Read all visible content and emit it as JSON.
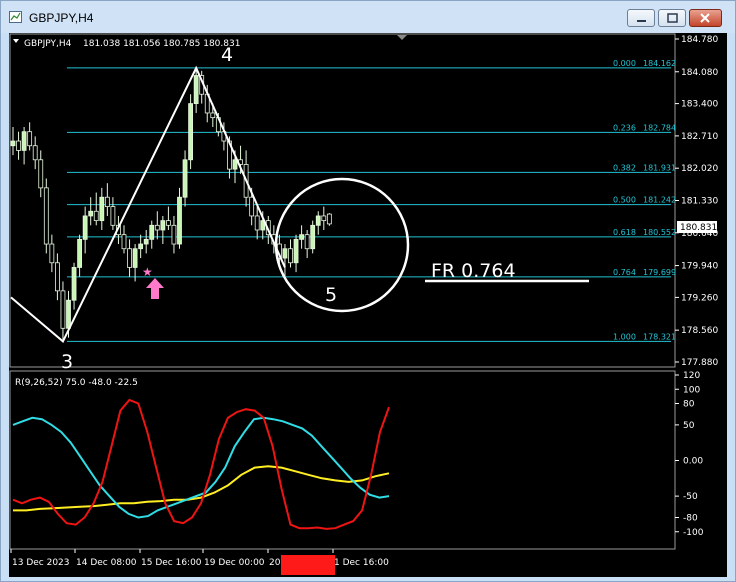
{
  "window": {
    "title": "GBPJPY,H4"
  },
  "chart_data": {
    "type": "candlestick",
    "symbol_label": "GBPJPY,H4",
    "ohlc_label": "181.038 181.056 180.785 180.831",
    "price_axis_ticks": [
      "184.780",
      "184.080",
      "183.400",
      "182.710",
      "182.020",
      "181.330",
      "180.640",
      "179.940",
      "179.260",
      "178.560",
      "177.880"
    ],
    "current_price": "180.831",
    "y_range": [
      177.88,
      184.78
    ],
    "candles": [
      {
        "o": 182.5,
        "h": 182.9,
        "l": 182.3,
        "c": 182.6
      },
      {
        "o": 182.6,
        "h": 182.8,
        "l": 182.2,
        "c": 182.4
      },
      {
        "o": 182.4,
        "h": 182.9,
        "l": 182.1,
        "c": 182.8
      },
      {
        "o": 182.8,
        "h": 183.0,
        "l": 182.4,
        "c": 182.5
      },
      {
        "o": 182.5,
        "h": 182.7,
        "l": 182.0,
        "c": 182.2
      },
      {
        "o": 182.2,
        "h": 182.4,
        "l": 181.4,
        "c": 181.6
      },
      {
        "o": 181.6,
        "h": 181.8,
        "l": 180.2,
        "c": 180.4
      },
      {
        "o": 180.4,
        "h": 180.6,
        "l": 179.8,
        "c": 180.0
      },
      {
        "o": 180.0,
        "h": 180.2,
        "l": 179.2,
        "c": 179.4
      },
      {
        "o": 179.4,
        "h": 179.6,
        "l": 178.32,
        "c": 178.6
      },
      {
        "o": 178.6,
        "h": 179.4,
        "l": 178.4,
        "c": 179.2
      },
      {
        "o": 179.2,
        "h": 180.0,
        "l": 179.0,
        "c": 179.9
      },
      {
        "o": 179.9,
        "h": 180.6,
        "l": 179.7,
        "c": 180.5
      },
      {
        "o": 180.5,
        "h": 181.2,
        "l": 180.2,
        "c": 181.0
      },
      {
        "o": 181.0,
        "h": 181.4,
        "l": 180.8,
        "c": 181.1
      },
      {
        "o": 181.1,
        "h": 181.5,
        "l": 180.8,
        "c": 180.9
      },
      {
        "o": 180.9,
        "h": 181.6,
        "l": 180.7,
        "c": 181.4
      },
      {
        "o": 181.4,
        "h": 181.7,
        "l": 181.0,
        "c": 181.2
      },
      {
        "o": 181.2,
        "h": 181.4,
        "l": 180.7,
        "c": 180.8
      },
      {
        "o": 180.8,
        "h": 181.0,
        "l": 180.4,
        "c": 180.6
      },
      {
        "o": 180.6,
        "h": 180.8,
        "l": 180.2,
        "c": 180.3
      },
      {
        "o": 180.3,
        "h": 180.5,
        "l": 179.7,
        "c": 179.9
      },
      {
        "o": 179.9,
        "h": 180.4,
        "l": 179.6,
        "c": 180.3
      },
      {
        "o": 180.3,
        "h": 180.6,
        "l": 180.1,
        "c": 180.4
      },
      {
        "o": 180.4,
        "h": 180.7,
        "l": 180.2,
        "c": 180.5
      },
      {
        "o": 180.5,
        "h": 180.9,
        "l": 180.3,
        "c": 180.8
      },
      {
        "o": 180.8,
        "h": 181.1,
        "l": 180.5,
        "c": 180.7
      },
      {
        "o": 180.7,
        "h": 181.0,
        "l": 180.4,
        "c": 180.9
      },
      {
        "o": 180.9,
        "h": 181.2,
        "l": 180.7,
        "c": 180.8
      },
      {
        "o": 180.8,
        "h": 181.0,
        "l": 180.2,
        "c": 180.4
      },
      {
        "o": 180.4,
        "h": 181.6,
        "l": 180.3,
        "c": 181.4
      },
      {
        "o": 181.4,
        "h": 182.4,
        "l": 181.2,
        "c": 182.2
      },
      {
        "o": 182.2,
        "h": 183.6,
        "l": 182.0,
        "c": 183.4
      },
      {
        "o": 183.4,
        "h": 184.16,
        "l": 183.2,
        "c": 184.0
      },
      {
        "o": 184.0,
        "h": 184.1,
        "l": 183.4,
        "c": 183.6
      },
      {
        "o": 183.6,
        "h": 183.8,
        "l": 183.0,
        "c": 183.2
      },
      {
        "o": 183.2,
        "h": 183.4,
        "l": 182.9,
        "c": 183.1
      },
      {
        "o": 183.1,
        "h": 183.2,
        "l": 182.7,
        "c": 182.8
      },
      {
        "o": 182.8,
        "h": 183.0,
        "l": 182.4,
        "c": 182.6
      },
      {
        "o": 182.6,
        "h": 182.7,
        "l": 181.8,
        "c": 182.0
      },
      {
        "o": 182.0,
        "h": 182.4,
        "l": 181.7,
        "c": 182.2
      },
      {
        "o": 182.2,
        "h": 182.5,
        "l": 181.9,
        "c": 182.1
      },
      {
        "o": 182.1,
        "h": 182.4,
        "l": 181.2,
        "c": 181.4
      },
      {
        "o": 181.4,
        "h": 181.6,
        "l": 180.8,
        "c": 181.0
      },
      {
        "o": 181.0,
        "h": 181.2,
        "l": 180.5,
        "c": 180.7
      },
      {
        "o": 180.7,
        "h": 181.1,
        "l": 180.5,
        "c": 180.9
      },
      {
        "o": 180.9,
        "h": 181.0,
        "l": 180.4,
        "c": 180.6
      },
      {
        "o": 180.6,
        "h": 180.8,
        "l": 180.2,
        "c": 180.4
      },
      {
        "o": 180.4,
        "h": 180.6,
        "l": 179.9,
        "c": 180.1
      },
      {
        "o": 180.1,
        "h": 180.4,
        "l": 179.7,
        "c": 180.3
      },
      {
        "o": 180.3,
        "h": 180.5,
        "l": 179.9,
        "c": 180.0
      },
      {
        "o": 180.0,
        "h": 180.6,
        "l": 179.8,
        "c": 180.5
      },
      {
        "o": 180.5,
        "h": 180.8,
        "l": 180.3,
        "c": 180.6
      },
      {
        "o": 180.6,
        "h": 180.7,
        "l": 180.1,
        "c": 180.3
      },
      {
        "o": 180.3,
        "h": 180.9,
        "l": 180.2,
        "c": 180.8
      },
      {
        "o": 180.8,
        "h": 181.1,
        "l": 180.6,
        "c": 181.0
      },
      {
        "o": 181.0,
        "h": 181.2,
        "l": 180.7,
        "c": 180.9
      },
      {
        "o": 181.04,
        "h": 181.06,
        "l": 180.79,
        "c": 180.83
      }
    ],
    "fib_levels": [
      {
        "label": "0.000",
        "price": "184.162",
        "v": 184.162
      },
      {
        "label": "0.236",
        "price": "182.784",
        "v": 182.784
      },
      {
        "label": "0.382",
        "price": "181.931",
        "v": 181.931
      },
      {
        "label": "0.500",
        "price": "181.242",
        "v": 181.242
      },
      {
        "label": "0.618",
        "price": "180.552",
        "v": 180.552
      },
      {
        "label": "0.764",
        "price": "179.699",
        "v": 179.699
      },
      {
        "label": "1.000",
        "price": "178.321",
        "v": 178.321
      }
    ],
    "wave_labels": [
      "3",
      "4",
      "5"
    ],
    "wave_points": [
      {
        "label": "3",
        "index": 9,
        "price": 178.32
      },
      {
        "label": "4",
        "index": 33,
        "price": 184.16
      },
      {
        "label": "5",
        "index": 49,
        "price": 179.9
      }
    ],
    "annotation": "FR 0.764",
    "indicator": {
      "label": "R(9,26,52) 75.0 -48.0 -22.5",
      "y_range": [
        -120,
        120
      ],
      "ticks": [
        "120",
        "100",
        "80",
        "50",
        "0.00",
        "-50",
        "-80",
        "-100"
      ],
      "red": [
        -55,
        -60,
        -55,
        -52,
        -58,
        -75,
        -88,
        -90,
        -80,
        -60,
        -30,
        20,
        70,
        85,
        80,
        40,
        -10,
        -60,
        -85,
        -88,
        -80,
        -60,
        -20,
        30,
        60,
        68,
        72,
        70,
        60,
        20,
        -40,
        -90,
        -95,
        -95,
        -94,
        -96,
        -95,
        -90,
        -85,
        -70,
        -20,
        40,
        75
      ],
      "cyan": [
        50,
        55,
        60,
        58,
        50,
        40,
        25,
        5,
        -15,
        -35,
        -50,
        -65,
        -75,
        -80,
        -78,
        -70,
        -65,
        -60,
        -55,
        -50,
        -45,
        -30,
        -10,
        20,
        40,
        58,
        60,
        58,
        55,
        50,
        45,
        35,
        20,
        5,
        -10,
        -25,
        -38,
        -48,
        -52,
        -50
      ],
      "yellow": [
        -70,
        -70,
        -68,
        -67,
        -66,
        -65,
        -64,
        -62,
        -60,
        -60,
        -58,
        -57,
        -55,
        -55,
        -52,
        -45,
        -35,
        -20,
        -10,
        -8,
        -10,
        -15,
        -20,
        -25,
        -28,
        -30,
        -28,
        -22,
        -18
      ],
      "x_labels": [
        "13 Dec 2023",
        "14 Dec 08:00",
        "15 Dec 16:00",
        "19 Dec 00:00",
        "20",
        "1 Dec 16:00"
      ]
    },
    "colors": {
      "background": "#000000",
      "bull": "#c9f5b5",
      "bear": "#000000",
      "candle_outline": "#e6f7de",
      "fib": "#23c3d4",
      "wave": "#ffffff",
      "ind_red": "#ee1414",
      "ind_cyan": "#30dde6",
      "ind_yellow": "#ffee22",
      "marker_pink": "#ff7acb",
      "highlight": "#ff1a1a"
    }
  }
}
